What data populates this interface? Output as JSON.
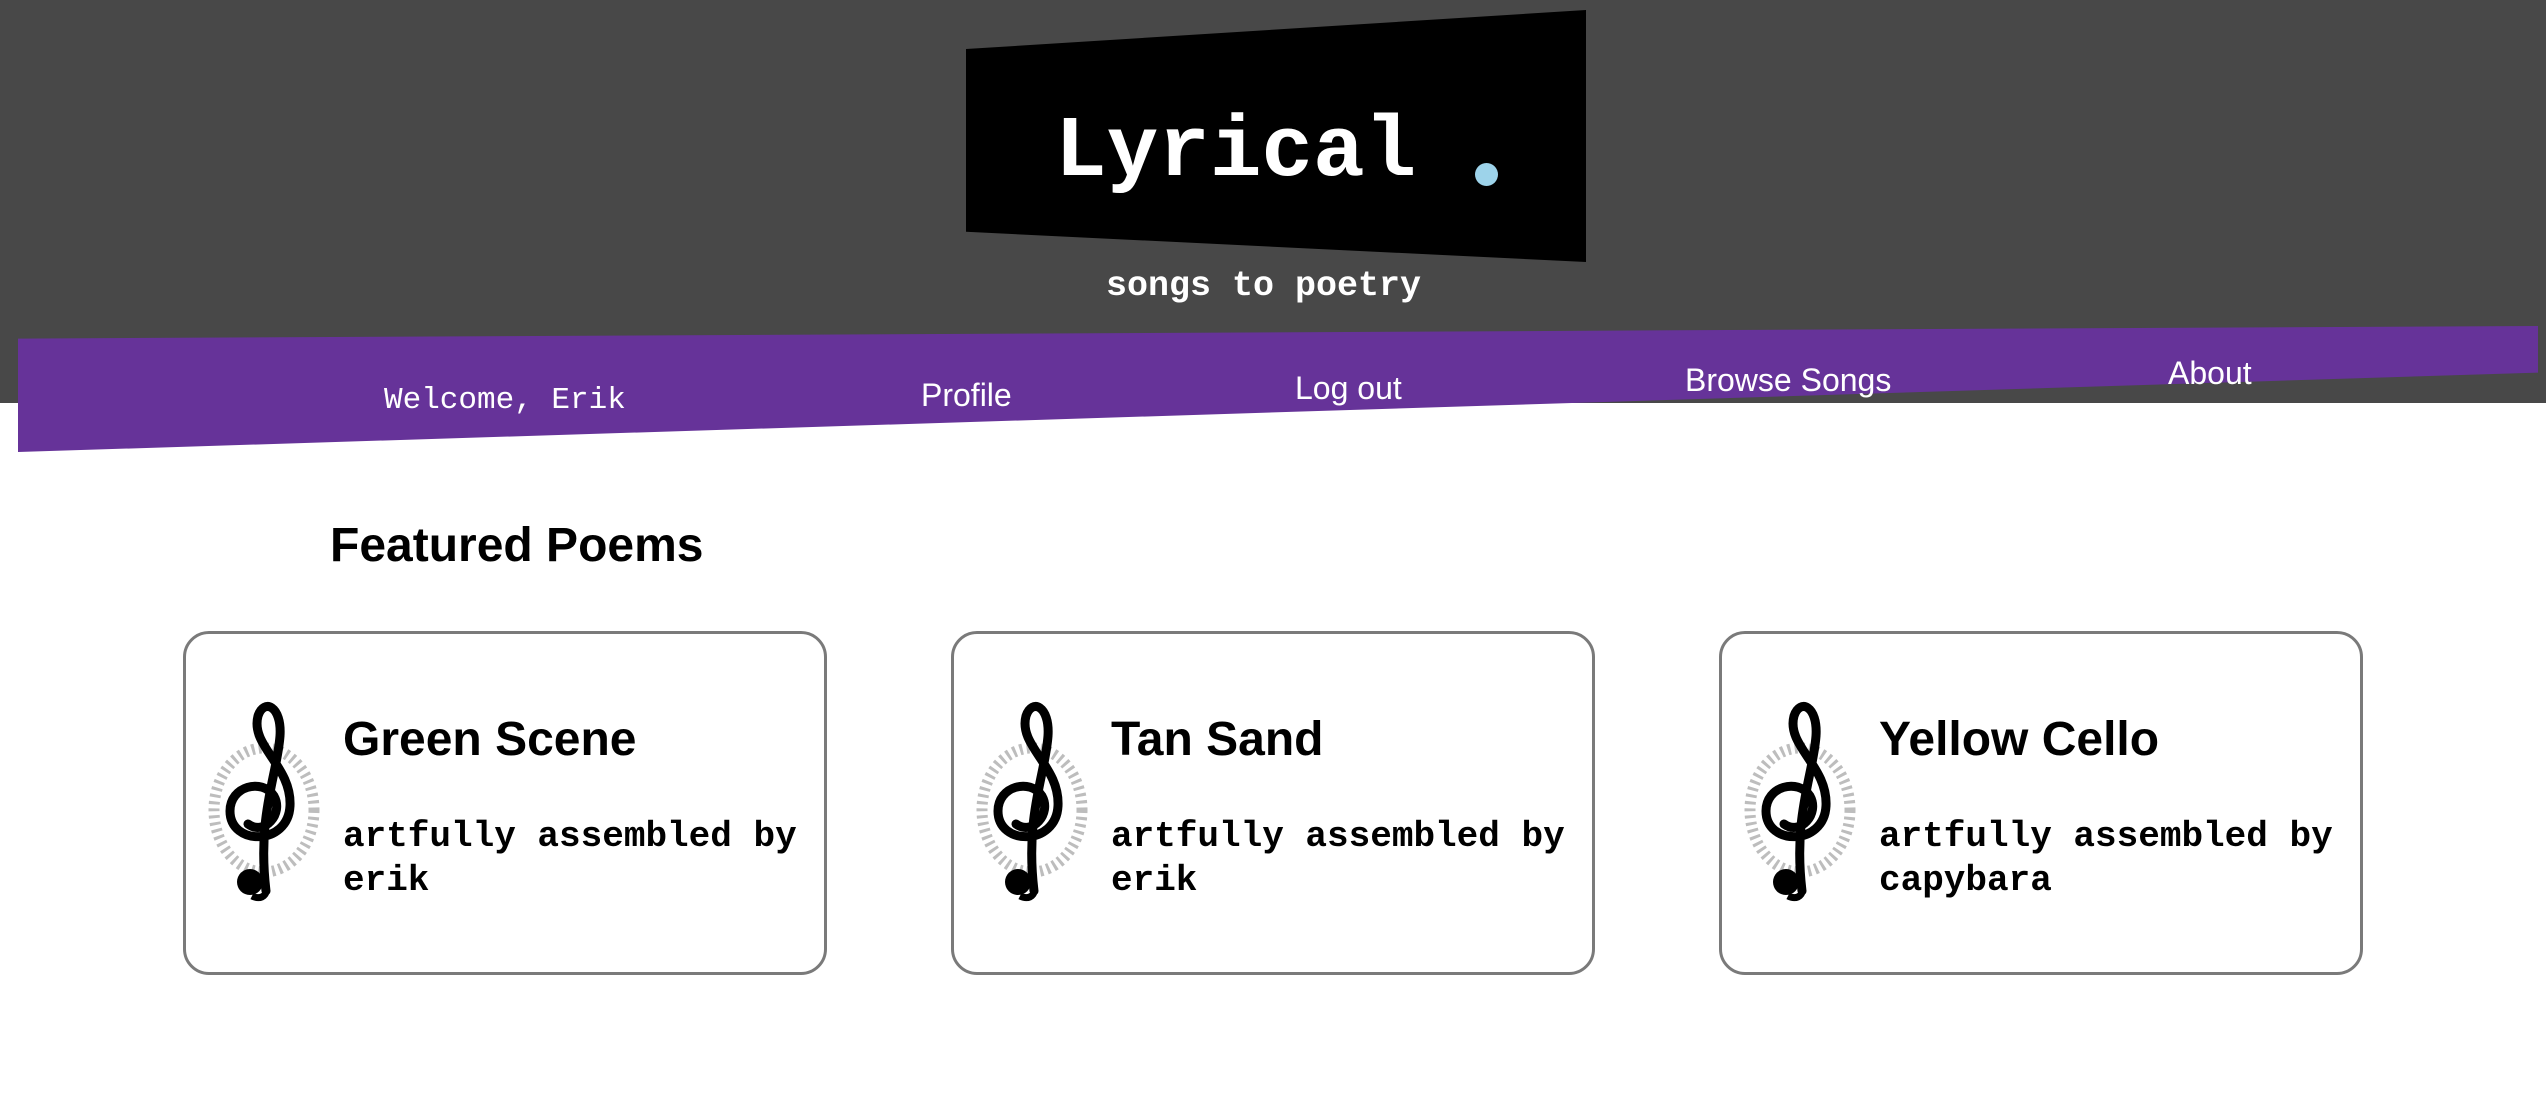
{
  "colors": {
    "header_bg": "#484848",
    "nav_band": "#663399",
    "logo_dot": "#9dd3ea",
    "card_border": "#7a7a7a"
  },
  "header": {
    "logo": "Lyrical",
    "tagline": "songs to poetry"
  },
  "nav": {
    "welcome": "Welcome, Erik",
    "profile": "Profile",
    "logout": "Log out",
    "browse": "Browse Songs",
    "about": "About"
  },
  "main": {
    "featured_title": "Featured Poems",
    "cards": [
      {
        "title": "Green Scene",
        "subtitle": "artfully assembled by erik",
        "icon": "treble-clef-icon"
      },
      {
        "title": "Tan Sand",
        "subtitle": "artfully assembled by erik",
        "icon": "treble-clef-icon"
      },
      {
        "title": "Yellow Cello",
        "subtitle": "artfully assembled by capybara",
        "icon": "treble-clef-icon"
      }
    ]
  }
}
